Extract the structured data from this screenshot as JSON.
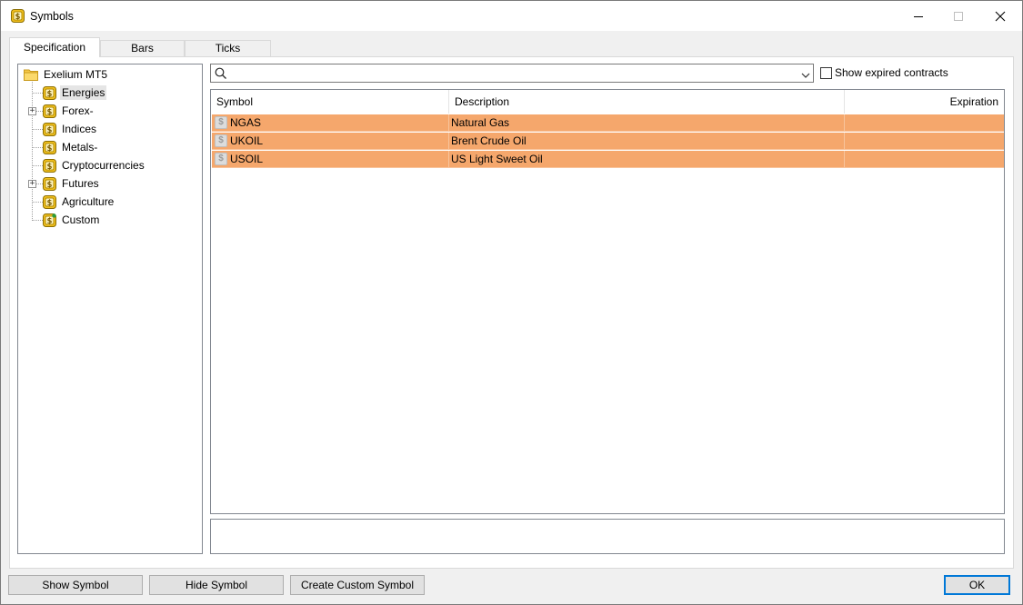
{
  "window": {
    "title": "Symbols",
    "close_symbol": "✕"
  },
  "tabs": [
    {
      "label": "Specification",
      "active": true
    },
    {
      "label": "Bars",
      "active": false
    },
    {
      "label": "Ticks",
      "active": false
    }
  ],
  "tree": {
    "root": "Exelium MT5",
    "items": [
      {
        "label": "Energies",
        "expandable": false,
        "selected": true
      },
      {
        "label": "Forex-",
        "expandable": true,
        "selected": false
      },
      {
        "label": "Indices",
        "expandable": false,
        "selected": false
      },
      {
        "label": "Metals-",
        "expandable": false,
        "selected": false
      },
      {
        "label": "Cryptocurrencies",
        "expandable": false,
        "selected": false
      },
      {
        "label": "Futures",
        "expandable": true,
        "selected": false
      },
      {
        "label": "Agriculture",
        "expandable": false,
        "selected": false
      },
      {
        "label": "Custom",
        "expandable": false,
        "selected": false
      }
    ]
  },
  "search": {
    "value": "",
    "placeholder": ""
  },
  "show_expired": {
    "label": "Show expired contracts",
    "checked": false
  },
  "table": {
    "headers": {
      "symbol": "Symbol",
      "description": "Description",
      "expiration": "Expiration"
    },
    "rows": [
      {
        "symbol": "NGAS",
        "description": "Natural Gas",
        "expiration": ""
      },
      {
        "symbol": "UKOIL",
        "description": "Brent Crude Oil",
        "expiration": ""
      },
      {
        "symbol": "USOIL",
        "description": "US Light Sweet Oil",
        "expiration": ""
      }
    ],
    "row_icon_glyph": "$"
  },
  "buttons": {
    "show_symbol": "Show Symbol",
    "hide_symbol": "Hide Symbol",
    "create_custom_symbol": "Create Custom Symbol",
    "ok": "OK"
  },
  "colors": {
    "row_highlight": "#f5a76c",
    "accent": "#0078d7",
    "folder": "#f7c948",
    "symbol_icon": "#f2c01e"
  }
}
